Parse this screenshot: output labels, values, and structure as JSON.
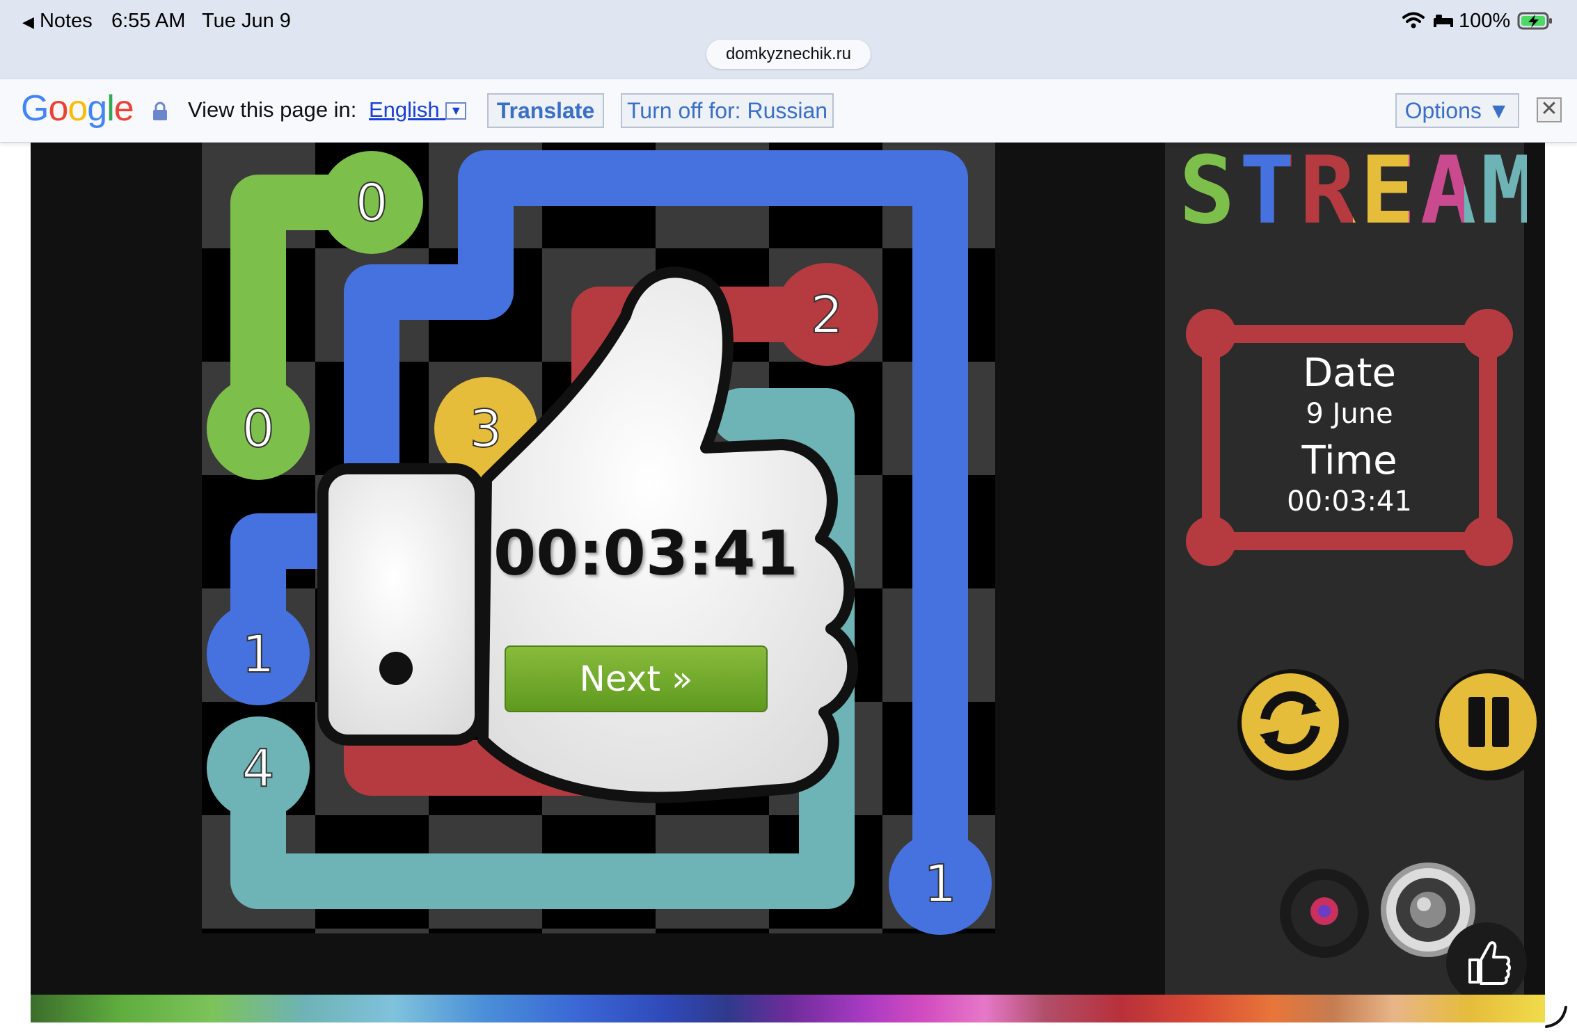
{
  "status_bar": {
    "back_app": "Notes",
    "time": "6:55 AM",
    "date": "Tue Jun 9",
    "battery": "100%",
    "icons": [
      "back-arrow-icon",
      "wifi-icon",
      "bed-icon",
      "battery-charging-icon"
    ]
  },
  "browser": {
    "url": "domkyznechik.ru"
  },
  "translate_bar": {
    "logo": "Google",
    "prompt": "View this page in:",
    "language": "English",
    "translate_button": "Translate",
    "turn_off_button": "Turn off for: Russian",
    "options_button": "Options ▼",
    "close_icon": "close-icon",
    "lock_icon": "lock-icon"
  },
  "game": {
    "logo": "STREAM",
    "board_numbers": [
      "0",
      "0",
      "2",
      "3",
      "1",
      "4",
      "1"
    ],
    "popup_time": "00:03:41",
    "next_button": "Next »",
    "info": {
      "date_label": "Date",
      "date_value": "9 June",
      "time_label": "Time",
      "time_value": "00:03:41"
    },
    "controls": [
      "restart-icon",
      "pause-icon",
      "music-icon",
      "sound-icon",
      "like-icon"
    ],
    "colors": {
      "green": "#7dbf4b",
      "blue": "#4672e0",
      "red": "#b63b40",
      "yellow": "#e6bc3b",
      "teal": "#6eb3b5"
    }
  }
}
